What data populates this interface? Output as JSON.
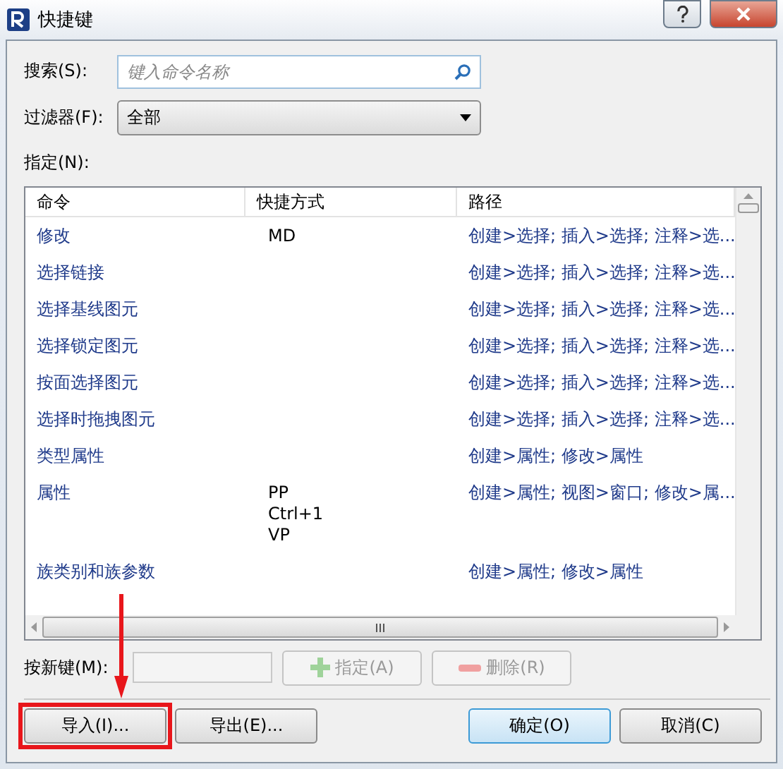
{
  "window": {
    "title": "快捷键"
  },
  "search": {
    "label": "搜索(S):",
    "placeholder": "键入命令名称"
  },
  "filter": {
    "label": "过滤器(F):",
    "value": "全部"
  },
  "assignments_label": "指定(N):",
  "table": {
    "columns": [
      "命令",
      "快捷方式",
      "路径"
    ],
    "rows": [
      {
        "command": "修改",
        "shortcuts": [
          "MD"
        ],
        "path": "创建>选择; 插入>选择; 注释>选..."
      },
      {
        "command": "选择链接",
        "shortcuts": [],
        "path": "创建>选择; 插入>选择; 注释>选..."
      },
      {
        "command": "选择基线图元",
        "shortcuts": [],
        "path": "创建>选择; 插入>选择; 注释>选..."
      },
      {
        "command": "选择锁定图元",
        "shortcuts": [],
        "path": "创建>选择; 插入>选择; 注释>选..."
      },
      {
        "command": "按面选择图元",
        "shortcuts": [],
        "path": "创建>选择; 插入>选择; 注释>选..."
      },
      {
        "command": "选择时拖拽图元",
        "shortcuts": [],
        "path": "创建>选择; 插入>选择; 注释>选..."
      },
      {
        "command": "类型属性",
        "shortcuts": [],
        "path": "创建>属性; 修改>属性"
      },
      {
        "command": "属性",
        "shortcuts": [
          "PP",
          "Ctrl+1",
          "VP"
        ],
        "path": "创建>属性; 视图>窗口; 修改>属..."
      },
      {
        "command": "族类别和族参数",
        "shortcuts": [],
        "path": "创建>属性; 修改>属性"
      }
    ]
  },
  "new_key": {
    "label": "按新键(M):"
  },
  "key_buttons": [
    {
      "kind": "assign",
      "label": "指定(A)",
      "disabled": true
    },
    {
      "kind": "remove",
      "label": "删除(R)",
      "disabled": true
    }
  ],
  "buttons": [
    {
      "label": "导入(I)...",
      "default": false,
      "highlighted": true
    },
    {
      "label": "导出(E)...",
      "default": false,
      "highlighted": false
    },
    {
      "label": "确定(O)",
      "default": true,
      "highlighted": false
    },
    {
      "label": "取消(C)",
      "default": false,
      "highlighted": false
    }
  ]
}
